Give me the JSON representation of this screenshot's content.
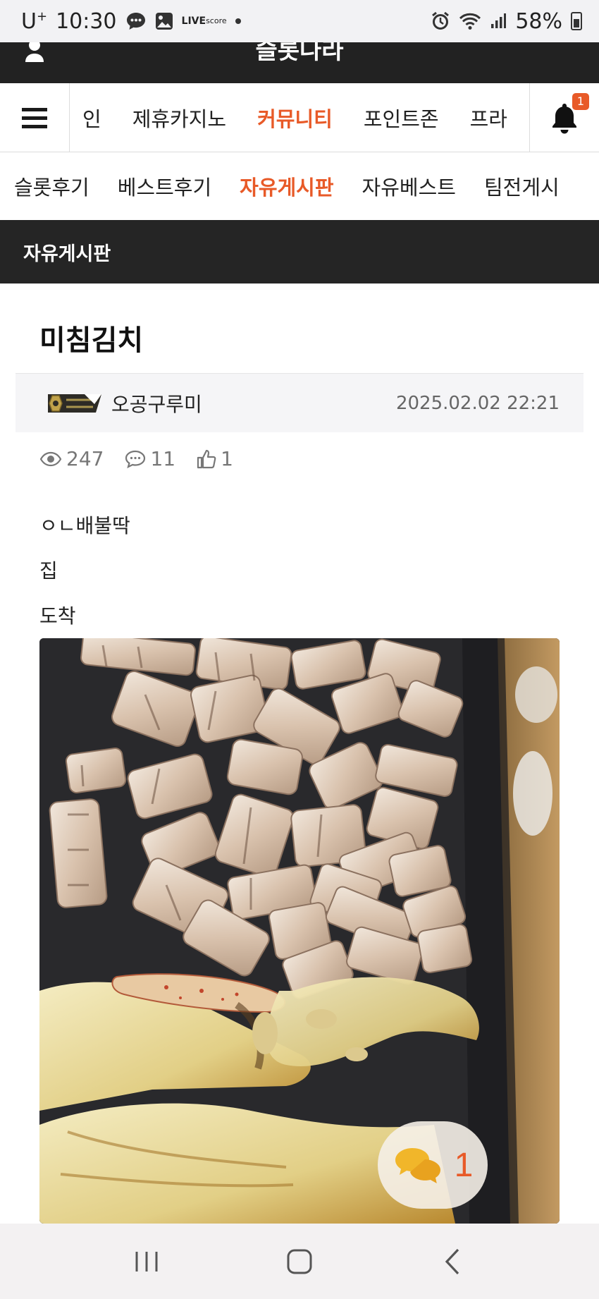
{
  "status_bar": {
    "carrier": "U",
    "carrier_sup": "+",
    "time": "10:30",
    "live_badge_top": "LIVE",
    "live_badge_bottom": "score",
    "battery": "58%"
  },
  "header": {
    "logo": "슬롯나라",
    "notification_count": "1"
  },
  "main_nav": {
    "items": [
      {
        "label": "인",
        "active": false
      },
      {
        "label": "제휴카지노",
        "active": false
      },
      {
        "label": "커뮤니티",
        "active": true
      },
      {
        "label": "포인트존",
        "active": false
      },
      {
        "label": "프라",
        "active": false
      }
    ]
  },
  "sub_nav": {
    "items": [
      {
        "label": "슬롯후기",
        "active": false
      },
      {
        "label": "베스트후기",
        "active": false
      },
      {
        "label": "자유게시판",
        "active": true
      },
      {
        "label": "자유베스트",
        "active": false
      },
      {
        "label": "팀전게시",
        "active": false
      }
    ]
  },
  "board": {
    "title": "자유게시판"
  },
  "post": {
    "title": "미침김치",
    "author": "오공구루미",
    "date": "2025.02.02 22:21",
    "views": "247",
    "comments": "11",
    "likes": "1",
    "body_lines": [
      "ㅇㄴ배불딱",
      "집",
      "도착"
    ]
  },
  "comment_fab": {
    "count": "1"
  },
  "colors": {
    "accent": "#e85a28",
    "header_dark": "#222222",
    "board_bar": "#252525"
  }
}
